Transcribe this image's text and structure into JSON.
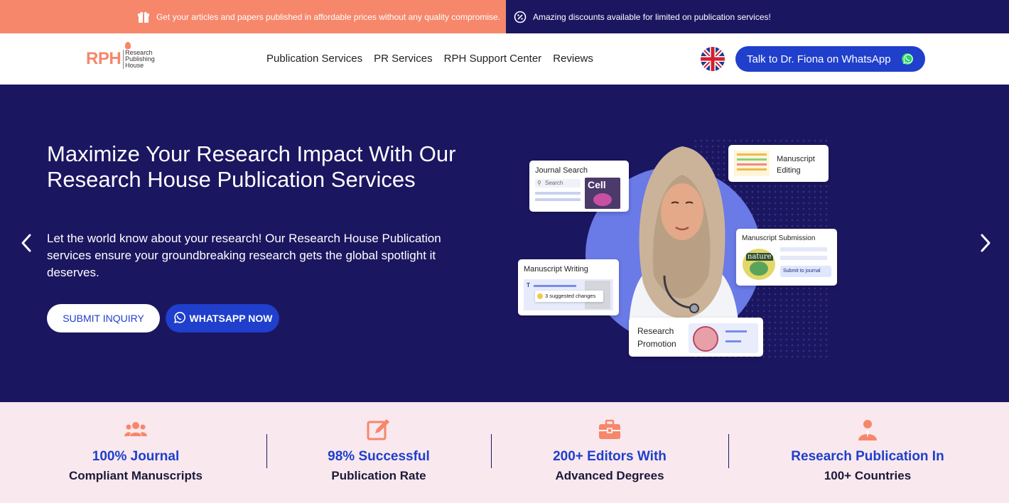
{
  "topbar": {
    "left_text": "Get your articles and papers published in affordable prices without any quality compromise.",
    "right_text": "Amazing discounts available for limited on publication services!",
    "left_bg": "#f6876b",
    "right_bg": "#1b1660"
  },
  "header": {
    "logo": {
      "short": "RPH",
      "line1": "Research",
      "line2": "Publishing",
      "line3": "House"
    },
    "nav": [
      {
        "label": "Publication Services"
      },
      {
        "label": "PR Services"
      },
      {
        "label": "RPH Support Center"
      },
      {
        "label": "Reviews"
      }
    ],
    "language_icon": "uk-flag-icon",
    "whatsapp_button": "Talk to Dr. Fiona on WhatsApp"
  },
  "hero": {
    "title": "Maximize Your Research Impact With Our Research House Publication Services",
    "description": "Let the world know about your research! Our Research House Publication services ensure your groundbreaking research gets the global spotlight it deserves.",
    "submit_button": "SUBMIT INQUIRY",
    "whatsapp_button": "WHATSAPP NOW",
    "prev_icon": "chevron-left-icon",
    "next_icon": "chevron-right-icon",
    "cards": {
      "journal_search": {
        "title": "Journal Search",
        "search_placeholder": "Search",
        "thumb": "Cell"
      },
      "manuscript_editing": {
        "title_line1": "Manuscript",
        "title_line2": "Editing"
      },
      "manuscript_submission": {
        "title": "Manuscript Submission",
        "thumb": "nature",
        "button": "Submit to journal"
      },
      "manuscript_writing": {
        "title": "Manuscript Writing",
        "suggestion": "3 suggested changes"
      },
      "research_promotion": {
        "title_line1": "Research",
        "title_line2": "Promotion"
      }
    },
    "bg": "#1b1660",
    "accent": "#1f3fcc"
  },
  "stats": [
    {
      "icon": "users-icon",
      "line1": "100% Journal",
      "line2": "Compliant Manuscripts"
    },
    {
      "icon": "edit-icon",
      "line1": "98% Successful",
      "line2": "Publication Rate"
    },
    {
      "icon": "briefcase-icon",
      "line1": "200+ Editors With",
      "line2": "Advanced Degrees"
    },
    {
      "icon": "person-icon",
      "line1": "Research Publication In",
      "line2": "100+ Countries"
    }
  ]
}
